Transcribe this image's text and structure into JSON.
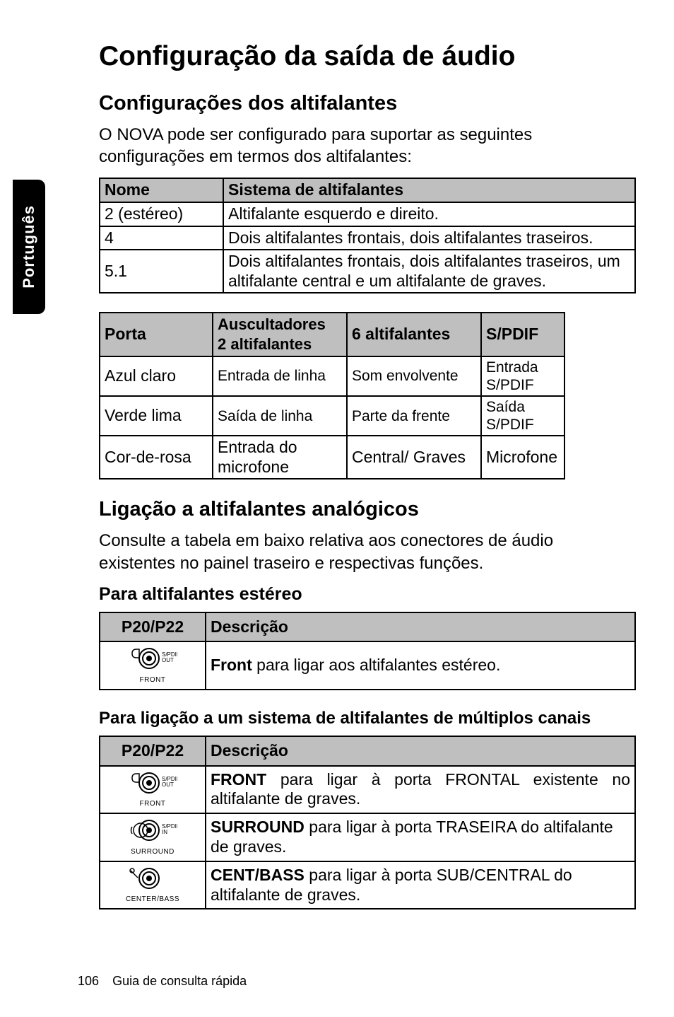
{
  "side_tab": "Português",
  "title": "Configuração da saída de áudio",
  "section1": {
    "heading": "Configurações dos altifalantes",
    "paragraph": "O NOVA pode ser configurado para suportar as seguintes configurações em termos dos altifalantes:"
  },
  "table1": {
    "headers": [
      "Nome",
      "Sistema de altifalantes"
    ],
    "rows": [
      [
        "2 (estéreo)",
        "Altifalante esquerdo e direito."
      ],
      [
        "4",
        "Dois altifalantes frontais, dois altifalantes traseiros."
      ],
      [
        "5.1",
        "Dois altifalantes frontais, dois altifalantes traseiros, um altifalante central e um altifalante de graves."
      ]
    ]
  },
  "table2": {
    "headers": [
      "Porta",
      "Auscultadores 2 altifalantes",
      "6 altifalantes",
      "S/PDIF"
    ],
    "rows": [
      [
        "Azul claro",
        "Entrada de linha",
        "Som envolvente",
        "Entrada S/PDIF"
      ],
      [
        "Verde lima",
        "Saída de linha",
        "Parte da frente",
        "Saída S/PDIF"
      ],
      [
        "Cor-de-rosa",
        "Entrada do microfone",
        "Central/ Graves",
        "Microfone"
      ]
    ]
  },
  "section2": {
    "heading": "Ligação a altifalantes analógicos",
    "paragraph": "Consulte a tabela em baixo relativa aos conectores de áudio existentes no painel traseiro e respectivas funções."
  },
  "sub1": {
    "heading": "Para altifalantes estéreo",
    "table": {
      "headers": [
        "P20/P22",
        "Descrição"
      ],
      "rows": [
        {
          "icon": "front",
          "desc_bold": "Front",
          "desc_rest": " para ligar aos altifalantes estéreo."
        }
      ]
    }
  },
  "sub2": {
    "heading": "Para ligação a um sistema de altifalantes de múltiplos canais",
    "table": {
      "headers": [
        "P20/P22",
        "Descrição"
      ],
      "rows": [
        {
          "icon": "front",
          "desc_bold": "FRONT",
          "desc_rest": " para ligar à porta FRONTAL existente no altifalante de graves."
        },
        {
          "icon": "surround",
          "desc_bold": "SURROUND",
          "desc_rest": " para ligar à porta TRASEIRA do altifalante de graves."
        },
        {
          "icon": "center",
          "desc_bold": "CENT/BASS",
          "desc_rest": " para ligar à porta SUB/CENTRAL do altifalante de graves."
        }
      ]
    }
  },
  "footer": {
    "page": "106",
    "text": "Guia de consulta rápida"
  },
  "icons": {
    "front_label": "FRONT",
    "surround_label": "SURROUND",
    "center_label": "CENTER/BASS",
    "spdif_out": "S/PDIF\nOUT",
    "spdif_in": "S/PDIF\nIN"
  }
}
